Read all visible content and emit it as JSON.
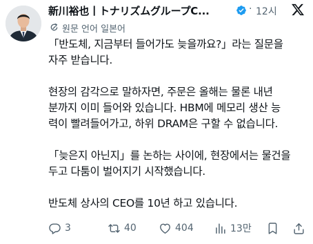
{
  "author": {
    "name": "新川裕也丨トナリズムグループC..."
  },
  "post": {
    "time": "12시"
  },
  "translation": {
    "label": "원문 언어 일본어"
  },
  "body": {
    "paragraphs": [
      [
        "「반도체, 지금부터 들어가도 늦을까요?」라는 질문을",
        "자주 받습니다."
      ],
      [
        "현장의 감각으로 말하자면, 주문은 올해는 물론 내년",
        "분까지 이미 들어와 있습니다. HBM에 메모리 생산 능",
        "력이 빨려들어가고, 하위 DRAM은 구할 수 없습니다."
      ],
      [
        "「늦은지 아닌지」를 논하는 사이에, 현장에서는 물건을",
        "두고 다툼이 벌어지기 시작했습니다."
      ],
      [
        "반도체 상사의 CEO를 10년 하고 있습니다."
      ]
    ]
  },
  "stats": {
    "replies": "3",
    "reposts": "40",
    "likes": "404",
    "views": "13만"
  },
  "icons": {
    "verified": "verified-badge-icon",
    "x_logo": "x-logo-icon",
    "translate": "translate-icon",
    "reply": "reply-icon",
    "repost": "repost-icon",
    "like": "heart-icon",
    "views": "views-icon",
    "bookmark": "bookmark-icon",
    "share": "share-icon"
  },
  "colors": {
    "text": "#0f1419",
    "secondary": "#536471",
    "verified": "#1d9bf0"
  }
}
